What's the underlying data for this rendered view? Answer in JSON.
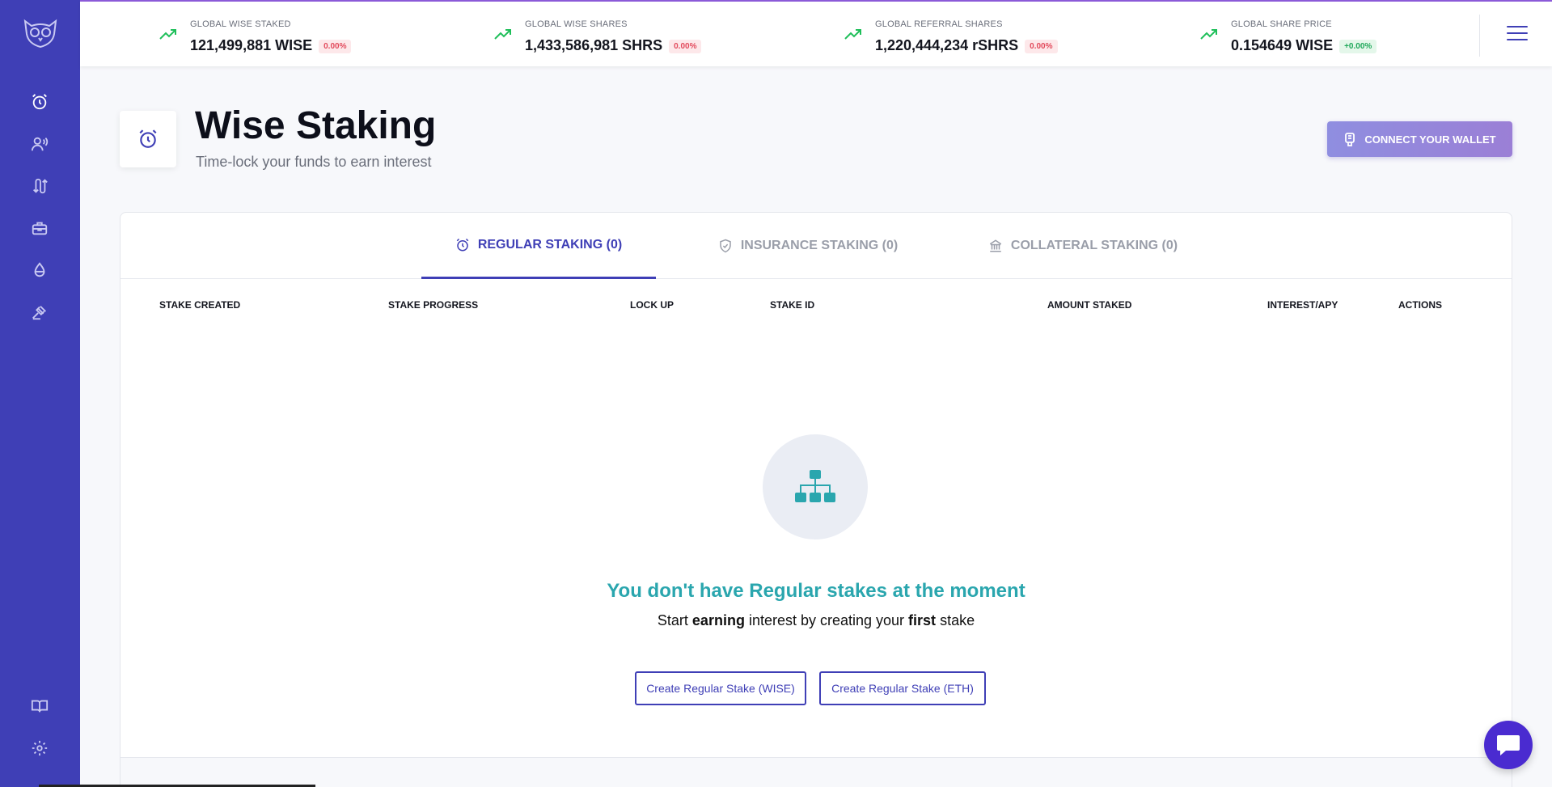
{
  "sidebar": {
    "items": [
      {
        "name": "staking",
        "icon": "alarm-clock-icon"
      },
      {
        "name": "referrals",
        "icon": "user-broadcast-icon"
      },
      {
        "name": "swap",
        "icon": "arrows-swap-icon"
      },
      {
        "name": "toolbox",
        "icon": "toolbox-icon"
      },
      {
        "name": "liquidity",
        "icon": "droplet-icon"
      },
      {
        "name": "governance",
        "icon": "gavel-icon"
      }
    ],
    "bottom_items": [
      {
        "name": "docs",
        "icon": "book-icon"
      },
      {
        "name": "settings",
        "icon": "gear-icon"
      }
    ],
    "bg_color": "#3f3fb6"
  },
  "stats": [
    {
      "label": "GLOBAL WISE STAKED",
      "value": "121,499,881 WISE",
      "change": "0.00%",
      "trend": "up"
    },
    {
      "label": "GLOBAL WISE SHARES",
      "value": "1,433,586,981 SHRS",
      "change": "0.00%",
      "trend": "up"
    },
    {
      "label": "GLOBAL REFERRAL SHARES",
      "value": "1,220,444,234 rSHRS",
      "change": "0.00%",
      "trend": "up"
    },
    {
      "label": "GLOBAL SHARE PRICE",
      "value": "0.154649 WISE",
      "change": "+0.00%",
      "trend": "up"
    }
  ],
  "header": {
    "title": "Wise Staking",
    "subtitle": "Time-lock your funds to earn interest",
    "connect_label": "CONNECT YOUR WALLET"
  },
  "tabs": [
    {
      "label": "REGULAR STAKING (0)",
      "icon": "alarm-clock-icon",
      "active": true
    },
    {
      "label": "INSURANCE STAKING (0)",
      "icon": "shield-check-icon",
      "active": false
    },
    {
      "label": "COLLATERAL STAKING (0)",
      "icon": "bank-icon",
      "active": false
    }
  ],
  "table": {
    "columns": [
      "STAKE CREATED",
      "STAKE PROGRESS",
      "LOCK UP",
      "STAKE ID",
      "AMOUNT STAKED",
      "INTEREST/APY",
      "ACTIONS"
    ]
  },
  "empty_state": {
    "icon": "sitemap-icon",
    "title": "You don't have Regular stakes at the moment",
    "sub_start": "Start ",
    "sub_bold1": "earning",
    "sub_mid": " interest by creating your ",
    "sub_bold2": "first",
    "sub_end": " stake",
    "button_wise": "Create Regular Stake (WISE)",
    "button_eth": "Create Regular Stake (ETH)"
  },
  "colors": {
    "accent": "#3f3fb6",
    "teal": "#2aa6ae",
    "trend_green": "#1fbf5a",
    "negative": "#e24a5c"
  }
}
